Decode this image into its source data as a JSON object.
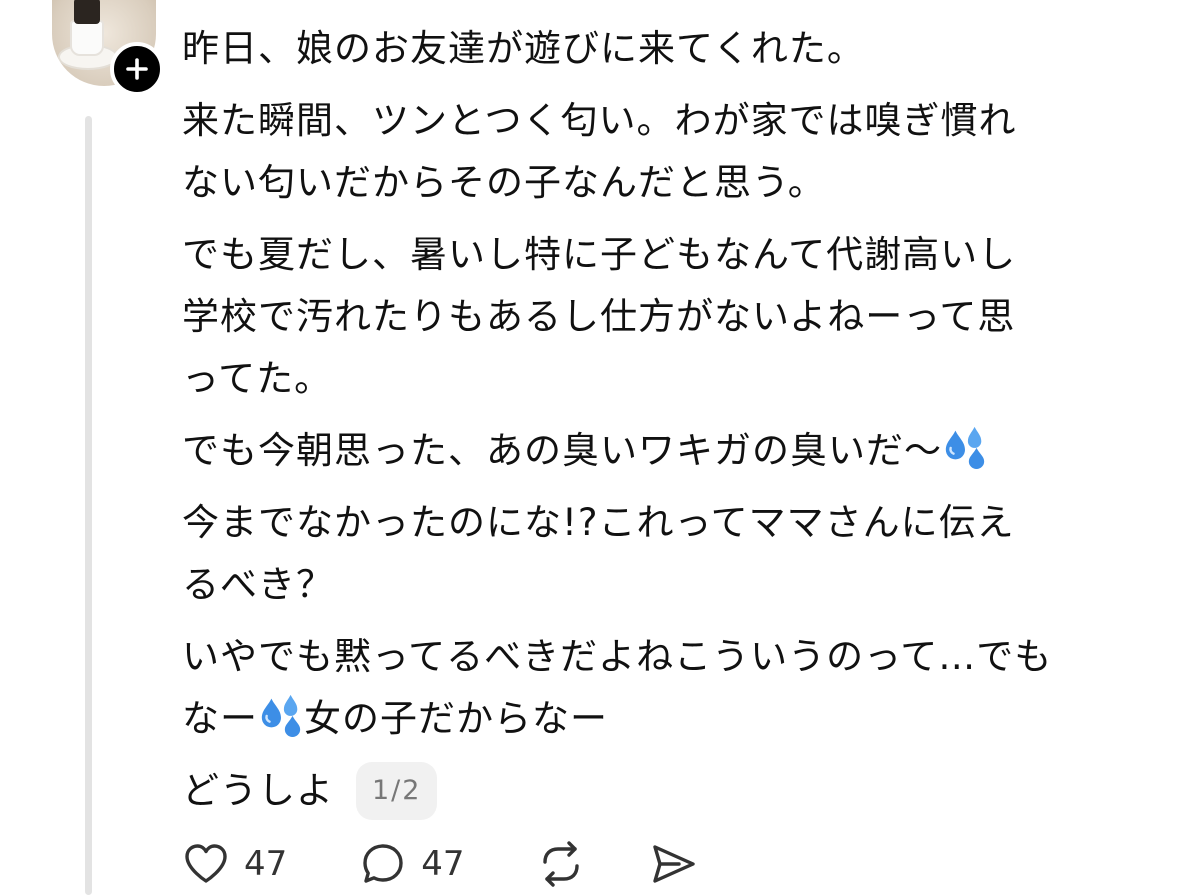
{
  "post": {
    "lines": [
      "昨日、娘のお友達が遊びに来てくれた。",
      "来た瞬間、ツンとつく匂い。わが家では嗅ぎ慣れ",
      "ない匂いだからその子なんだと思う。",
      "でも夏だし、暑いし特に子どもなんて代謝高いし",
      "学校で汚れたりもあるし仕方がないよねーって思",
      "ってた。",
      "でも今朝思った、あの臭いワキガの臭いだ〜",
      "今までなかったのにな!?これってママさんに伝え",
      "るべき？",
      "いやでも黙ってるべきだよねこういうのって…でも",
      "なー",
      "女の子だからなー",
      "どうしよ"
    ],
    "page_counter": "1/2",
    "emoji": "sweat-droplets-icon"
  },
  "actions": {
    "like_count": "47",
    "reply_count": "47"
  },
  "colors": {
    "text": "#111111",
    "thread_line": "#e3e3e3",
    "counter_bg": "#f1f1f1",
    "counter_text": "#777777",
    "icon": "#333333",
    "badge": "#000000"
  }
}
